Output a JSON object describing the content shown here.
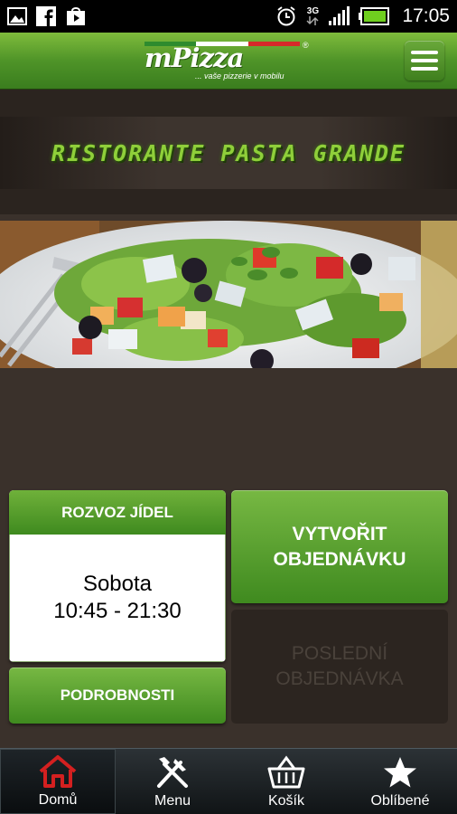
{
  "status_bar": {
    "time": "17:05",
    "network": "3G",
    "icons": [
      "gallery-icon",
      "facebook-icon",
      "play-store-icon",
      "alarm-icon",
      "network-3g-icon",
      "signal-icon",
      "battery-icon"
    ]
  },
  "app_bar": {
    "logo_text": "mPizza",
    "logo_registered": "®",
    "logo_tagline": "... vaše pizzerie v mobilu",
    "menu_icon": "hamburger-menu-icon",
    "colors": {
      "bar": "#4f9428",
      "accent": "#7fbc3c"
    }
  },
  "restaurant": {
    "name": "Ristorante Pasta Grande",
    "image": "salad-photo"
  },
  "delivery": {
    "header": "ROZVOZ JÍDEL",
    "day": "Sobota",
    "hours": "10:45 - 21:30"
  },
  "buttons": {
    "details": "PODROBNOSTI",
    "create_order": "VYTVOŘIT OBJEDNÁVKU",
    "last_order": "POSLEDNÍ OBJEDNÁVKA"
  },
  "bottom_nav": [
    {
      "label": "Domů",
      "icon": "home-icon",
      "active": true,
      "color": "#d42020"
    },
    {
      "label": "Menu",
      "icon": "fork-knife-icon",
      "active": false
    },
    {
      "label": "Košík",
      "icon": "basket-icon",
      "active": false
    },
    {
      "label": "Oblíbené",
      "icon": "star-icon",
      "active": false
    }
  ]
}
